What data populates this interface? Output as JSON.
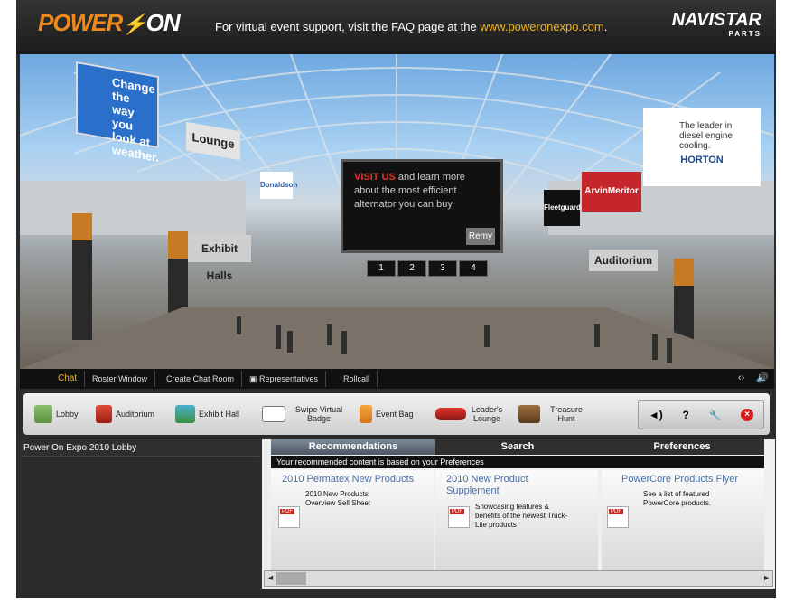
{
  "header": {
    "logo_part1": "POWER",
    "logo_part2": "ON",
    "support_text": "For virtual event support, visit the FAQ page at the",
    "support_url": "www.poweronexpo.com",
    "support_end": ".",
    "brand_name": "NAVISTAR",
    "brand_sub": "PARTS"
  },
  "scene": {
    "shell_sign": "Change the way you look at weather.",
    "lounge_sign": "Lounge",
    "screen_visit": "VISIT US",
    "screen_text": " and learn more about the most efficient alternator you can buy.",
    "screen_logo": "Remy",
    "screen_numbers": [
      "1",
      "2",
      "3",
      "4"
    ],
    "exhibit_halls_sign": "Exhibit Halls",
    "auditorium_sign": "Auditorium",
    "sponsors": [
      "Fleetguard",
      "ArvinMeritor",
      "HORTON"
    ],
    "horton_tagline": "The leader in diesel engine cooling.",
    "left_booth": "Donaldson",
    "banner_text": "POWER ON"
  },
  "strip": {
    "tabs": [
      "Chat",
      "Roster Window",
      "Create Chat Room",
      "Representatives",
      "Rollcall"
    ]
  },
  "nav": {
    "items": [
      {
        "label": "Lobby"
      },
      {
        "label": "Auditorium"
      },
      {
        "label": "Exhibit Hall"
      },
      {
        "label": "Swipe Virtual Badge"
      },
      {
        "label": "Event Bag"
      },
      {
        "label": "Leader's Lounge"
      },
      {
        "label": "Treasure Hunt"
      }
    ],
    "controls": {
      "sound": "◄)",
      "help": "?",
      "settings": "🔧",
      "close": "×"
    }
  },
  "left_panel": {
    "title": "Power On Expo 2010 Lobby"
  },
  "right_panel": {
    "tabs": [
      "Recommendations",
      "Search",
      "Preferences"
    ],
    "notice": "Your recommended content is based on your Preferences",
    "cards": [
      {
        "title": "2010 Permatex New Products",
        "desc": "2010 New Products Overview Sell Sheet"
      },
      {
        "title": "2010 New Product Supplement",
        "desc": "Showcasing features & benefits of the newest Truck-Lite products"
      },
      {
        "title": "PowerCore Products Flyer",
        "desc": "See a list of featured PowerCore products."
      }
    ],
    "pdf_label": "PDF"
  },
  "colors": {
    "accent_orange": "#f08a1c",
    "url_yellow": "#f2b51c",
    "tab_active": "#4c5864",
    "link_blue": "#4d6fa0"
  }
}
